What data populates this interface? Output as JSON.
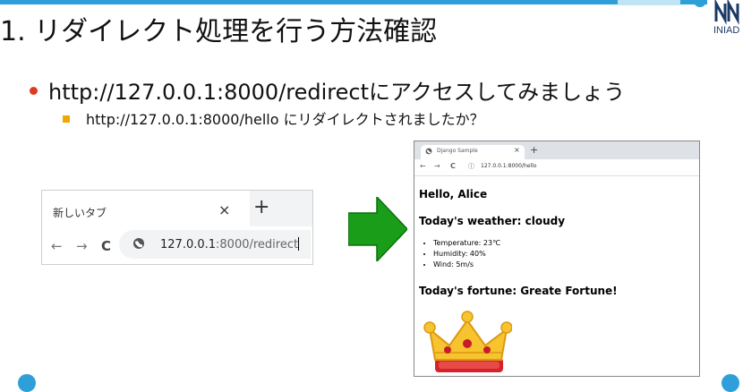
{
  "slide": {
    "title": "1. リダイレクト処理を行う方法確認",
    "logo_text": "INIAD",
    "bullet_main": "http://127.0.0.1:8000/redirectにアクセスしてみましょう",
    "bullet_sub": "http://127.0.0.1:8000/hello にリダイレクトされましたか？"
  },
  "browser_before": {
    "tab_title": "新しいタブ",
    "close_glyph": "×",
    "new_tab_glyph": "+",
    "back_glyph": "←",
    "forward_glyph": "→",
    "reload_glyph": "C",
    "url_host": "127.0.0.1",
    "url_rest": ":8000/redirect"
  },
  "browser_after": {
    "tab_title": "Django Sample",
    "close_glyph": "×",
    "new_tab_glyph": "+",
    "back_glyph": "←",
    "forward_glyph": "→",
    "reload_glyph": "C",
    "info_glyph": "ⓘ",
    "url": "127.0.0.1:8000/hello",
    "page": {
      "greeting": "Hello, Alice",
      "weather_heading": "Today's weather: cloudy",
      "weather_items": [
        "Temperature: 23℃",
        "Humidity: 40%",
        "Wind: 5m/s"
      ],
      "fortune_heading": "Today's fortune: Greate Fortune!"
    }
  },
  "colors": {
    "accent": "#2e9fd8",
    "bullet_dot": "#e03a1e",
    "bullet_square": "#f0a800",
    "arrow": "#1a9e1a"
  },
  "icons": {
    "globe": "globe-icon",
    "crown": "crown-image",
    "arrow": "right-arrow-icon"
  }
}
